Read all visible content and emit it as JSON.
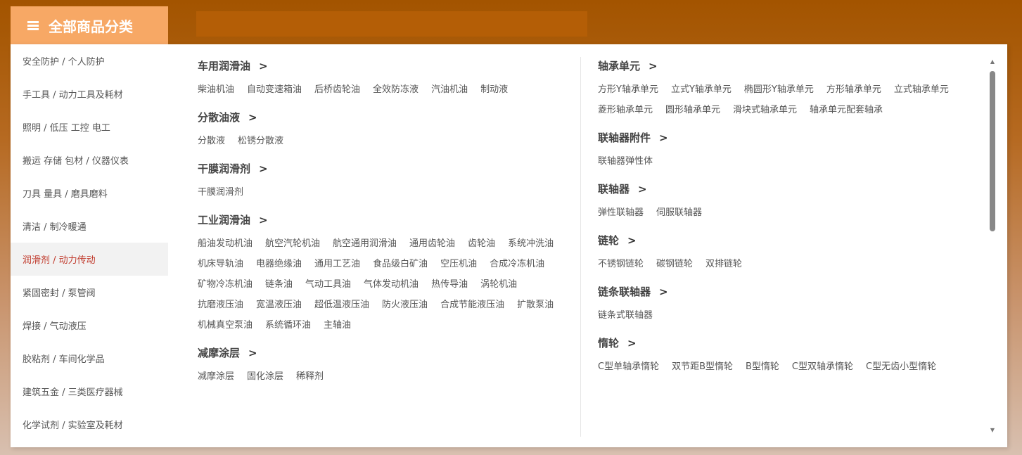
{
  "header": {
    "title": "全部商品分类",
    "accent_color": "#f7a865"
  },
  "sidebar": {
    "items": [
      {
        "label": "安全防护 / 个人防护"
      },
      {
        "label": "手工具 / 动力工具及耗材"
      },
      {
        "label": "照明 / 低压 工控 电工"
      },
      {
        "label": "搬运 存储 包材 / 仪器仪表"
      },
      {
        "label": "刀具 量具 / 磨具磨料"
      },
      {
        "label": "清洁 / 制冷暖通"
      },
      {
        "label": "润滑剂 / 动力传动"
      },
      {
        "label": "紧固密封 / 泵管阀"
      },
      {
        "label": "焊接 / 气动液压"
      },
      {
        "label": "胶粘剂 / 车间化学品"
      },
      {
        "label": "建筑五金 / 三类医疗器械"
      },
      {
        "label": "化学试剂 / 实验室及耗材"
      }
    ],
    "active_index": 6
  },
  "left_groups": [
    {
      "title": "车用润滑油",
      "arrow": ">",
      "items": [
        "柴油机油",
        "自动变速箱油",
        "后桥齿轮油",
        "全效防冻液",
        "汽油机油",
        "制动液"
      ]
    },
    {
      "title": "分散油液",
      "arrow": ">",
      "items": [
        "分散液",
        "松锈分散液"
      ]
    },
    {
      "title": "干膜润滑剂",
      "arrow": ">",
      "items": [
        "干膜润滑剂"
      ]
    },
    {
      "title": "工业润滑油",
      "arrow": ">",
      "items": [
        "船油发动机油",
        "航空汽轮机油",
        "航空通用润滑油",
        "通用齿轮油",
        "齿轮油",
        "系统冲洗油",
        "机床导轨油",
        "电器绝缘油",
        "通用工艺油",
        "食品级白矿油",
        "空压机油",
        "合成冷冻机油",
        "矿物冷冻机油",
        "链条油",
        "气动工具油",
        "气体发动机油",
        "热传导油",
        "涡轮机油",
        "抗磨液压油",
        "宽温液压油",
        "超低温液压油",
        "防火液压油",
        "合成节能液压油",
        "扩散泵油",
        "机械真空泵油",
        "系统循环油",
        "主轴油"
      ]
    },
    {
      "title": "减摩涂层",
      "arrow": ">",
      "items": [
        "减摩涂层",
        "固化涂层",
        "稀释剂"
      ]
    }
  ],
  "right_groups": [
    {
      "title": "轴承单元",
      "arrow": ">",
      "items": [
        "方形Y轴承单元",
        "立式Y轴承单元",
        "椭圆形Y轴承单元",
        "方形轴承单元",
        "立式轴承单元",
        "菱形轴承单元",
        "圆形轴承单元",
        "滑块式轴承单元",
        "轴承单元配套轴承"
      ]
    },
    {
      "title": "联轴器附件",
      "arrow": ">",
      "items": [
        "联轴器弹性体"
      ]
    },
    {
      "title": "联轴器",
      "arrow": ">",
      "items": [
        "弹性联轴器",
        "伺服联轴器"
      ]
    },
    {
      "title": "链轮",
      "arrow": ">",
      "items": [
        "不锈钢链轮",
        "碳钢链轮",
        "双排链轮"
      ]
    },
    {
      "title": "链条联轴器",
      "arrow": ">",
      "items": [
        "链条式联轴器"
      ]
    },
    {
      "title": "惰轮",
      "arrow": ">",
      "items": [
        "C型单轴承惰轮",
        "双节距B型惰轮",
        "B型惰轮",
        "C型双轴承惰轮",
        "C型无齿小型惰轮"
      ]
    }
  ],
  "scrollbar": {
    "up_icon": "▲",
    "down_icon": "▼"
  }
}
